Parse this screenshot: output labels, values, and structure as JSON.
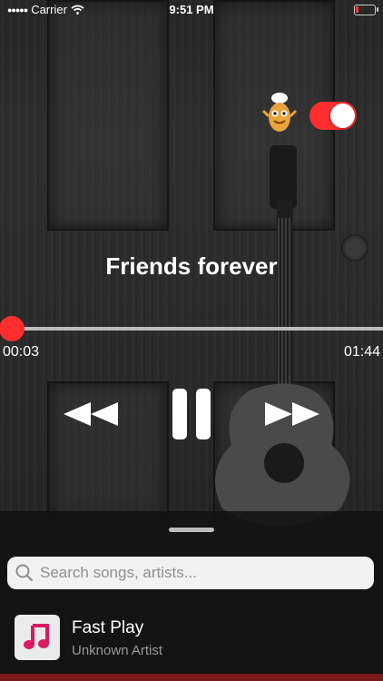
{
  "status_bar": {
    "carrier": "Carrier",
    "time": "9:51 PM",
    "battery_level": 0.1
  },
  "player": {
    "title": "Friends forever",
    "elapsed": "00:03",
    "duration": "01:44",
    "progress": 0.03,
    "toggle_on": true,
    "accent_color": "#ff2d2d"
  },
  "search": {
    "placeholder": "Search songs, artists..."
  },
  "song_list": [
    {
      "title": "Fast Play",
      "artist": "Unknown Artist",
      "icon": "music-note-icon"
    }
  ]
}
